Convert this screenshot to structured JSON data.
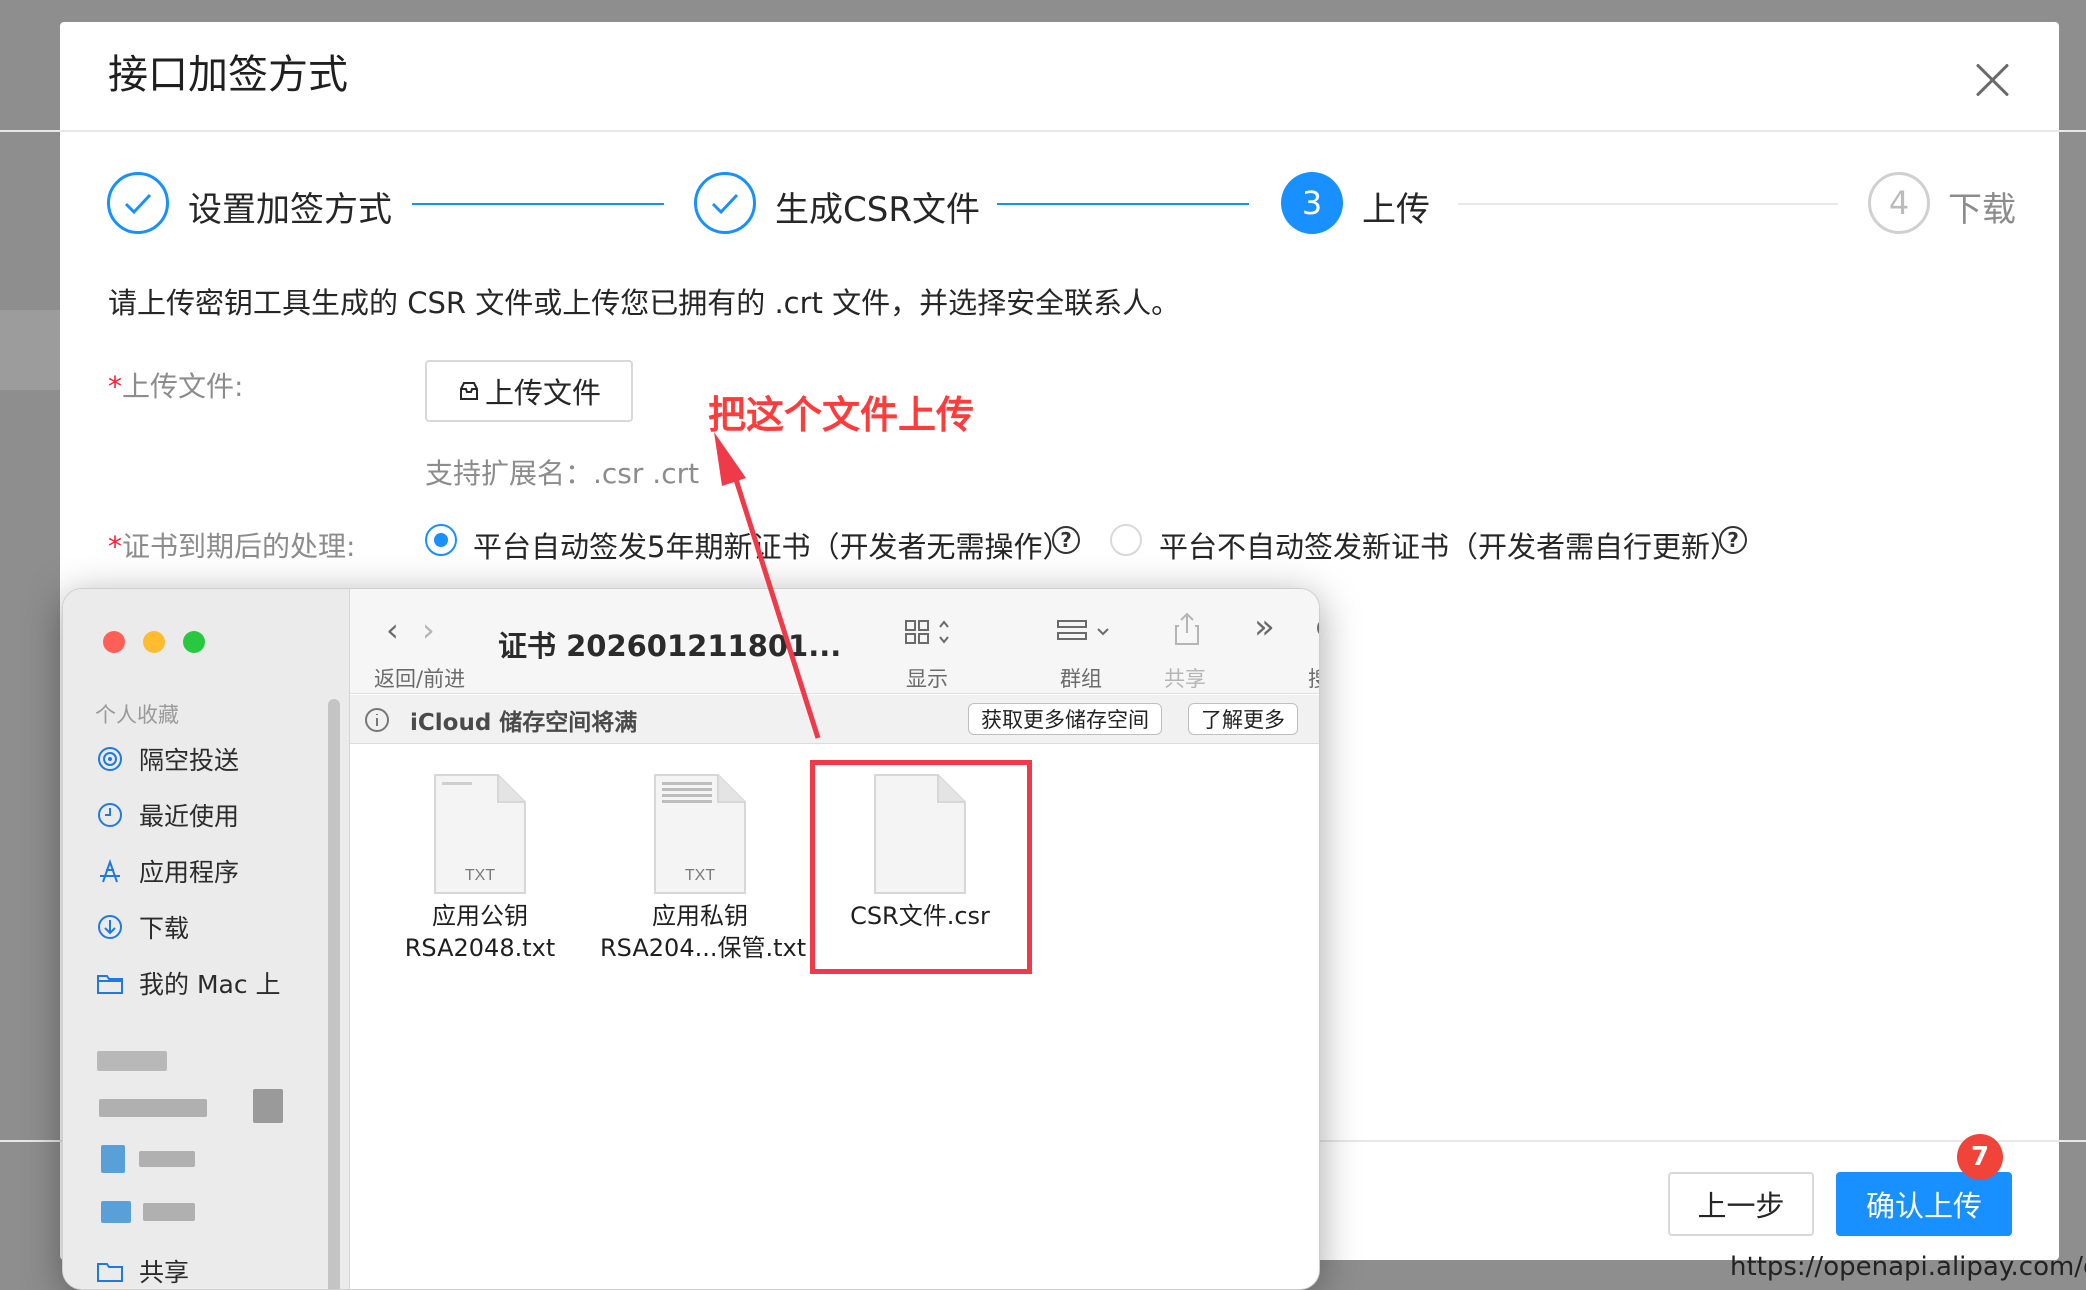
{
  "modal": {
    "title": "接口加签方式",
    "steps": [
      {
        "index": "1",
        "label": "设置加签方式",
        "status": "done"
      },
      {
        "index": "2",
        "label": "生成CSR文件",
        "status": "done"
      },
      {
        "index": "3",
        "label": "上传",
        "status": "active"
      },
      {
        "index": "4",
        "label": "下载",
        "status": "wait"
      }
    ],
    "description": "请上传密钥工具生成的 CSR 文件或上传您已拥有的 .crt 文件，并选择安全联系人。",
    "upload_label": "上传文件:",
    "upload_button": "上传文件",
    "upload_hint": "支持扩展名：.csr .crt",
    "annotation": "把这个文件上传",
    "expiry_label": "证书到期后的处理:",
    "radio_options": [
      {
        "label": "平台自动签发5年期新证书（开发者无需操作）",
        "checked": true
      },
      {
        "label": "平台不自动签发新证书（开发者需自行更新）",
        "checked": false
      }
    ],
    "buttons": {
      "prev": "上一步",
      "confirm": "确认上传"
    },
    "badge": "7"
  },
  "url_fragment": "https://openapi.alipay.com/gate",
  "finder": {
    "path_title": "证书 202601211801...",
    "toolbar": {
      "back_forward": "返回/前进",
      "view": "显示",
      "group": "群组",
      "share": "共享",
      "search": "搜索"
    },
    "icloud": {
      "message": "iCloud 储存空间将满",
      "get_more": "获取更多储存空间",
      "learn_more": "了解更多"
    },
    "sidebar": {
      "favorites_header": "个人收藏",
      "items": [
        {
          "label": "隔空投送",
          "icon": "airdrop-icon"
        },
        {
          "label": "最近使用",
          "icon": "clock-icon"
        },
        {
          "label": "应用程序",
          "icon": "applications-icon"
        },
        {
          "label": "下载",
          "icon": "download-icon"
        },
        {
          "label": "我的 Mac 上",
          "icon": "folder-icon"
        }
      ],
      "partial_item": "共享"
    },
    "files": [
      {
        "line1": "应用公钥",
        "line2": "RSA2048.txt",
        "badge": "TXT"
      },
      {
        "line1": "应用私钥",
        "line2": "RSA204...保管.txt",
        "badge": "TXT"
      },
      {
        "line1": "CSR文件.csr",
        "line2": "",
        "badge": ""
      }
    ]
  },
  "colors": {
    "primary": "#1890ff",
    "required": "#f5222d",
    "annotation": "#ff3b3b",
    "highlight_box": "#ef3a4a"
  }
}
